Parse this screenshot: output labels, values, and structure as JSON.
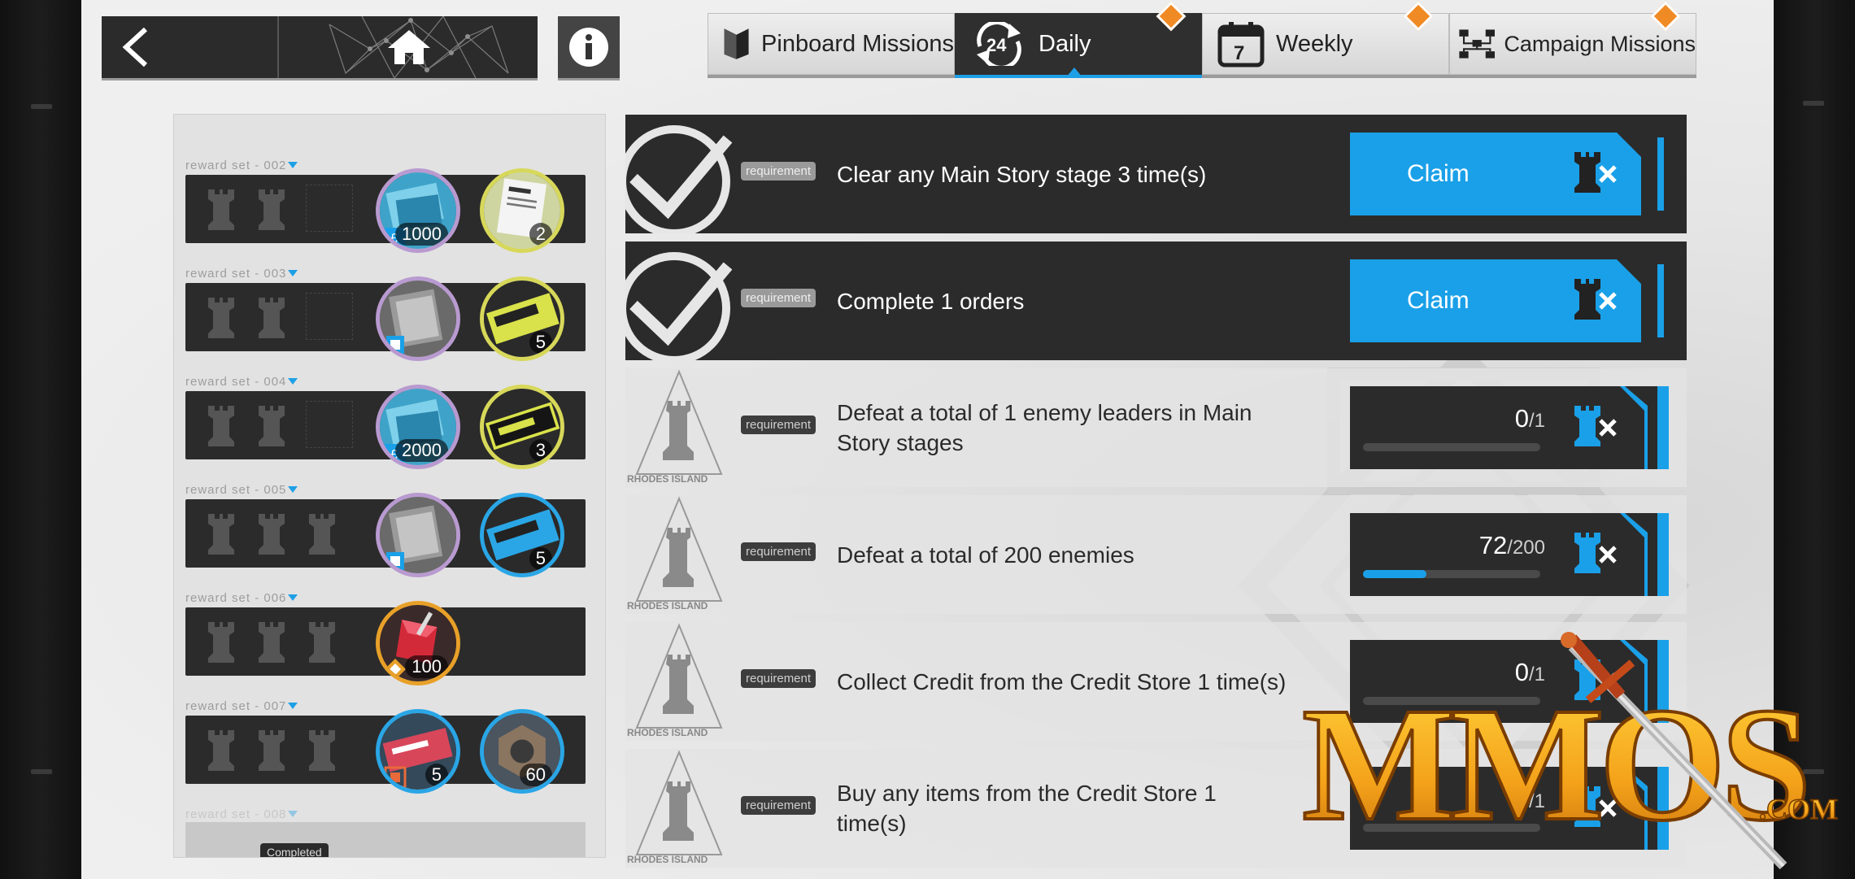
{
  "header": {
    "tabs": [
      {
        "label": "Pinboard Missions",
        "active": false,
        "notification": false
      },
      {
        "label": "Daily",
        "active": true,
        "notification": true
      },
      {
        "label": "Weekly",
        "active": false,
        "notification": true
      },
      {
        "label": "Campaign Missions",
        "active": false,
        "notification": true
      }
    ],
    "daily_icon_text": "24",
    "weekly_icon_text": "7"
  },
  "reward_sets": [
    {
      "label": "reward set - 002",
      "items": [
        {
          "qty": "1000"
        },
        {
          "qty": "2"
        }
      ]
    },
    {
      "label": "reward set - 003",
      "items": [
        {
          "qty": ""
        },
        {
          "qty": "5"
        }
      ]
    },
    {
      "label": "reward set - 004",
      "items": [
        {
          "qty": "2000"
        },
        {
          "qty": "3"
        }
      ]
    },
    {
      "label": "reward set - 005",
      "items": [
        {
          "qty": ""
        },
        {
          "qty": "5"
        }
      ]
    },
    {
      "label": "reward set - 006",
      "items": [
        {
          "qty": "100"
        }
      ]
    },
    {
      "label": "reward set - 007",
      "items": [
        {
          "qty": "5"
        },
        {
          "qty": "60"
        }
      ]
    },
    {
      "label": "reward set - 008",
      "items": []
    }
  ],
  "completed_badge": "Completed",
  "missions": [
    {
      "requirement_tag": "requirement",
      "text": "Clear any Main Story stage 3 time(s)",
      "status": "claimable",
      "action_label": "Claim"
    },
    {
      "requirement_tag": "requirement",
      "text": "Complete 1 orders",
      "status": "claimable",
      "action_label": "Claim"
    },
    {
      "requirement_tag": "requirement",
      "text": "Defeat a total of 1 enemy leaders in Main Story stages",
      "status": "in_progress",
      "current": "0",
      "total": "/1",
      "progress_fraction": 0
    },
    {
      "requirement_tag": "requirement",
      "text": "Defeat a total of 200 enemies",
      "status": "in_progress",
      "current": "72",
      "total": "/200",
      "progress_fraction": 0.36
    },
    {
      "requirement_tag": "requirement",
      "text": "Collect Credit from the Credit Store 1 time(s)",
      "status": "in_progress",
      "current": "0",
      "total": "/1",
      "progress_fraction": 0
    },
    {
      "requirement_tag": "requirement",
      "text": "Buy any items from the Credit Store 1 time(s)",
      "status": "in_progress",
      "current": "0",
      "total": "/1",
      "progress_fraction": 0
    }
  ],
  "mission_icon_caption": "RHODES ISLAND",
  "watermark": {
    "text": "MMOS",
    "suffix": ".COM"
  },
  "colors": {
    "accent": "#1aa0e8",
    "notification": "#f08a24",
    "panel_dark": "#2b2b2b"
  }
}
